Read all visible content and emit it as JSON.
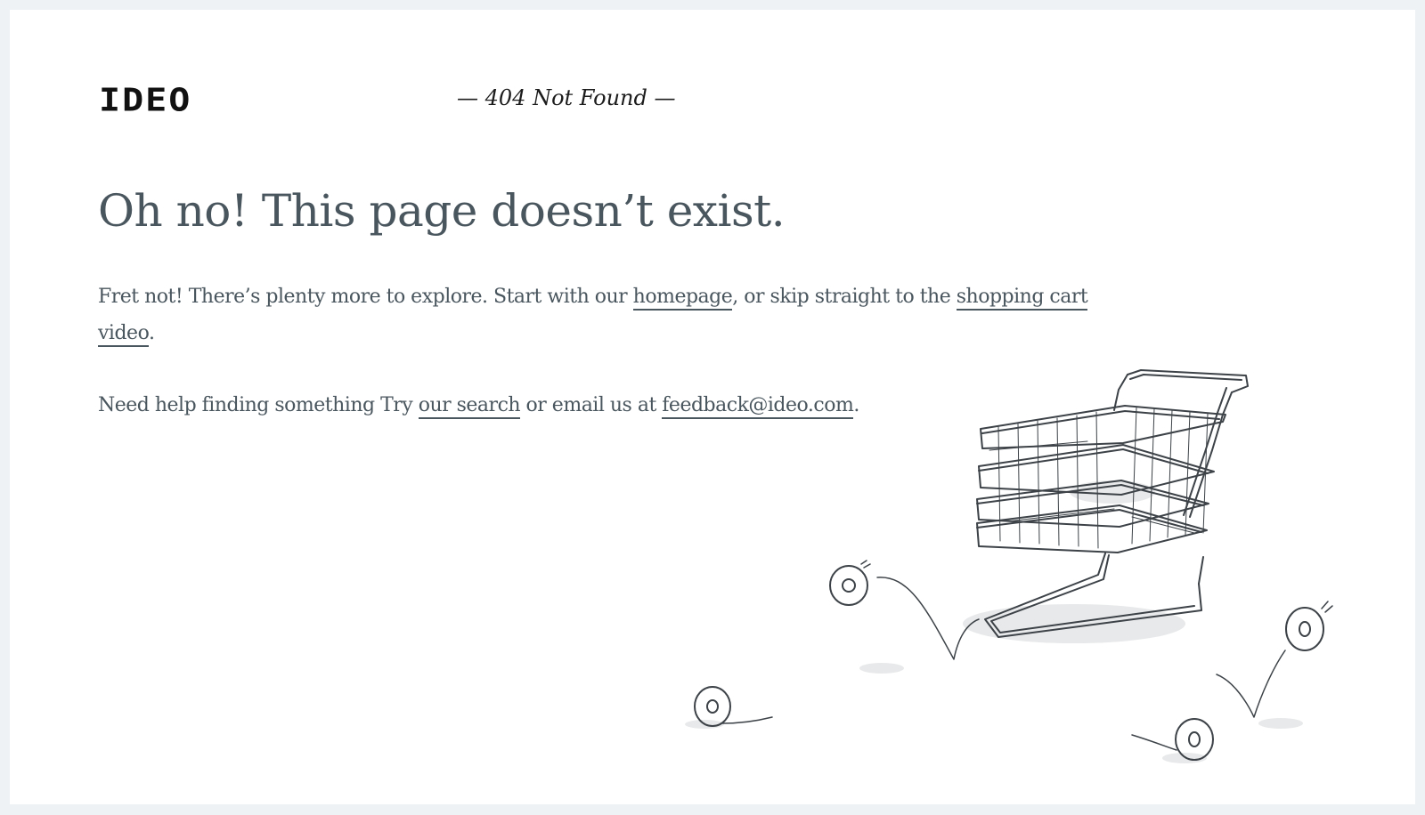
{
  "header": {
    "logo_text": "IDEO",
    "status_text": "— 404 Not Found —"
  },
  "main": {
    "headline": "Oh no! This page doesn’t exist.",
    "para1": {
      "text_before": "Fret not! There’s plenty more to explore. Start with our ",
      "link_homepage": "homepage",
      "text_middle": ", or skip straight to the ",
      "link_video": "shopping cart video",
      "text_after": "."
    },
    "para2": {
      "text_before": "Need help finding something Try ",
      "link_search": "our search",
      "text_middle": " or email us at ",
      "link_email": "feedback@ideo.com",
      "text_after": "."
    }
  },
  "colors": {
    "text": "#4a565e",
    "background": "#ffffff",
    "frame": "#eef2f5"
  },
  "illustration": {
    "icon": "shopping-cart-with-bouncing-wheels-illustration"
  }
}
